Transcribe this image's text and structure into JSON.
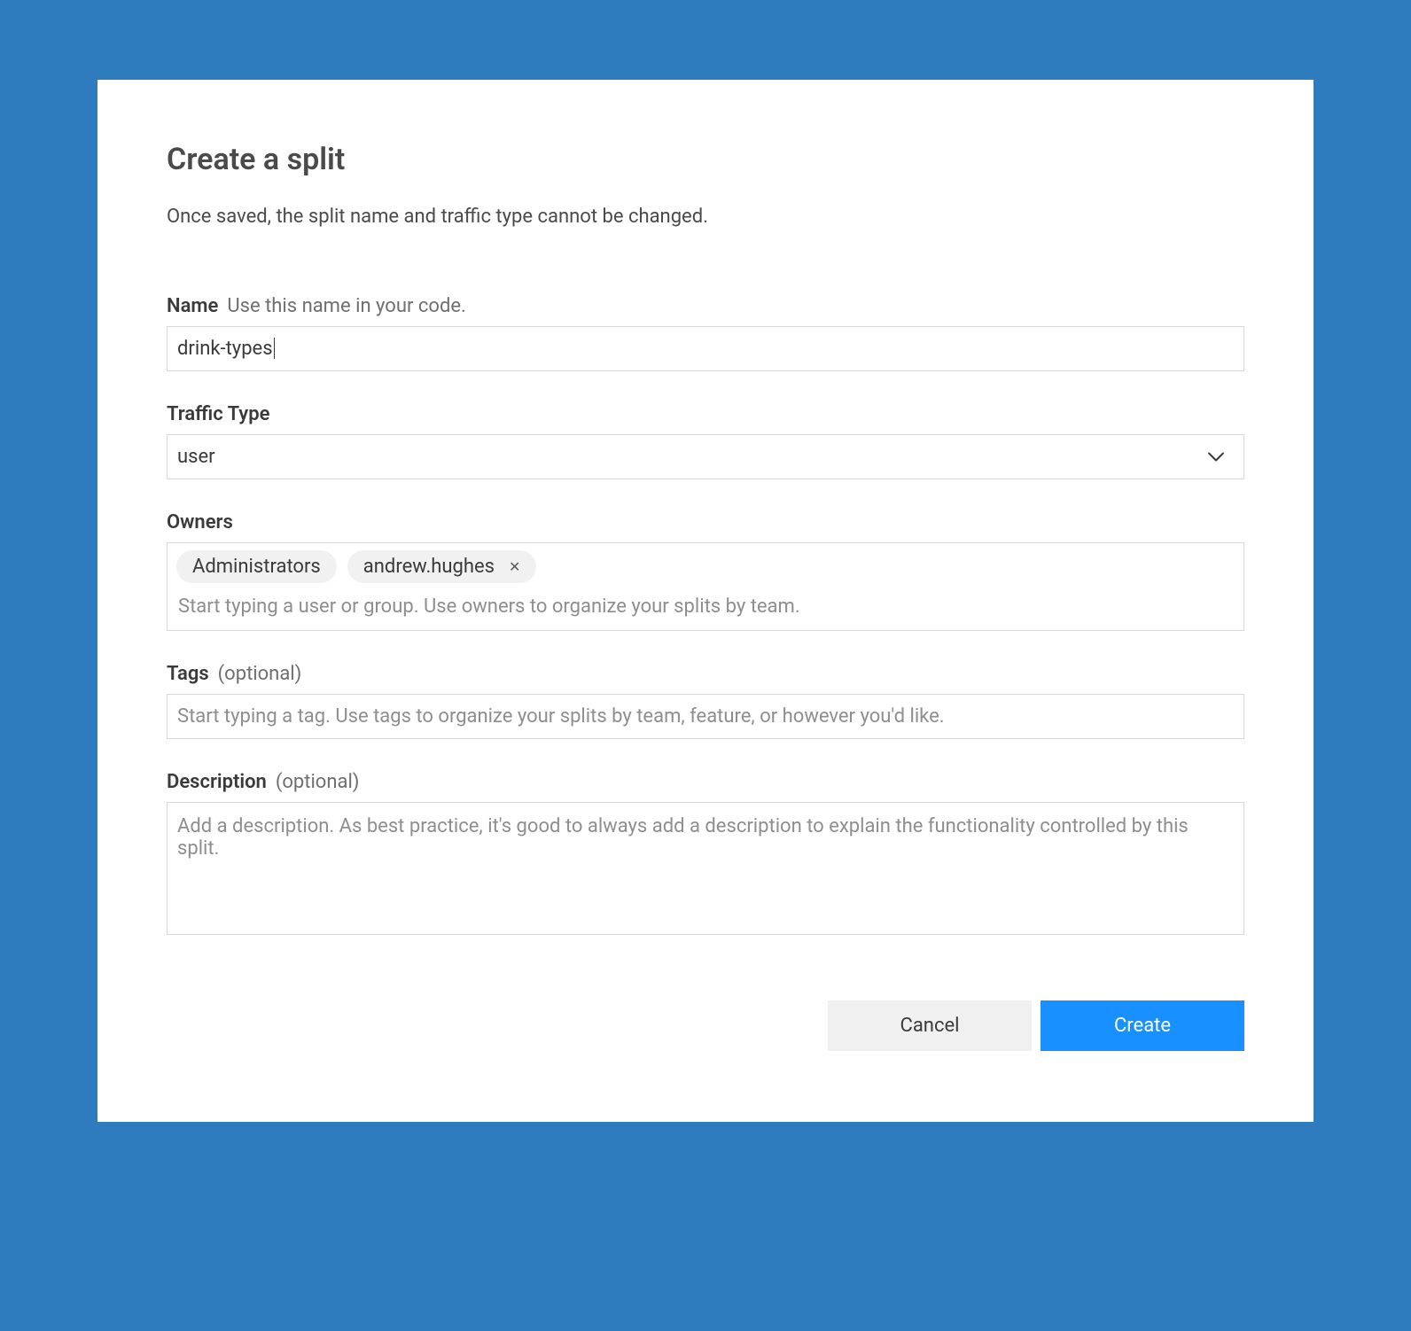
{
  "modal": {
    "title": "Create a split",
    "subtitle": "Once saved, the split name and traffic type cannot be changed."
  },
  "name": {
    "label": "Name",
    "hint": "Use this name in your code.",
    "value": "drink-types"
  },
  "trafficType": {
    "label": "Traffic Type",
    "value": "user"
  },
  "owners": {
    "label": "Owners",
    "chips": [
      {
        "label": "Administrators",
        "removable": false
      },
      {
        "label": "andrew.hughes",
        "removable": true
      }
    ],
    "hint": "Start typing a user or group. Use owners to organize your splits by team."
  },
  "tags": {
    "label": "Tags",
    "optional": "(optional)",
    "placeholder": "Start typing a tag. Use tags to organize your splits by team, feature, or however you'd like."
  },
  "description": {
    "label": "Description",
    "optional": "(optional)",
    "placeholder": "Add a description. As best practice, it's good to always add a description to explain the functionality controlled by this split."
  },
  "buttons": {
    "cancel": "Cancel",
    "create": "Create"
  }
}
